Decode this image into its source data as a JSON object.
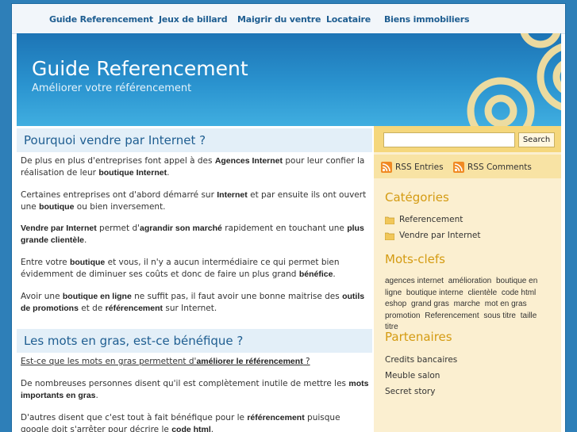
{
  "nav": {
    "items": [
      "Guide Referencement",
      "Jeux de billard",
      "Maigrir du ventre",
      "Locataire",
      "Biens immobiliers"
    ]
  },
  "header": {
    "title": "Guide Referencement",
    "tagline": "Améliorer votre référencement"
  },
  "posts": [
    {
      "title": "Pourquoi vendre par Internet ?",
      "paragraphs": [
        {
          "segments": [
            {
              "t": "De plus en plus d'entreprises font appel à des "
            },
            {
              "t": "Agences Internet",
              "b": true
            },
            {
              "t": " pour leur confier la réalisation de leur "
            },
            {
              "t": "boutique Internet",
              "b": true
            },
            {
              "t": "."
            }
          ]
        },
        {
          "segments": [
            {
              "t": "Certaines entreprises ont d'abord démarré sur "
            },
            {
              "t": "Internet",
              "b": true
            },
            {
              "t": " et par ensuite ils ont ouvert une "
            },
            {
              "t": "boutique",
              "b": true
            },
            {
              "t": " ou bien inversement."
            }
          ]
        },
        {
          "segments": [
            {
              "t": "Vendre par Internet",
              "b": true
            },
            {
              "t": " permet d'"
            },
            {
              "t": "agrandir son marché",
              "b": true
            },
            {
              "t": " rapidement en touchant une "
            },
            {
              "t": "plus grande clientèle",
              "b": true
            },
            {
              "t": "."
            }
          ]
        },
        {
          "segments": [
            {
              "t": "Entre votre "
            },
            {
              "t": "boutique",
              "b": true
            },
            {
              "t": " et vous, il n'y a aucun intermédiaire ce qui permet bien évidemment de diminuer ses coûts et donc de faire un plus grand "
            },
            {
              "t": "bénéfice",
              "b": true
            },
            {
              "t": "."
            }
          ]
        },
        {
          "segments": [
            {
              "t": "Avoir une "
            },
            {
              "t": "boutique en ligne",
              "b": true
            },
            {
              "t": " ne suffit pas, il faut avoir une bonne maitrise des "
            },
            {
              "t": "outils de promotions",
              "b": true
            },
            {
              "t": " et de "
            },
            {
              "t": "référencement",
              "b": true
            },
            {
              "t": " sur Internet."
            }
          ]
        }
      ]
    },
    {
      "title": "Les mots en gras, est-ce bénéfique ?",
      "paragraphs": [
        {
          "segments": [
            {
              "t": "Est-ce que les mots en gras permettent d'",
              "u": true
            },
            {
              "t": "améliorer le référencement",
              "b": true,
              "u": true
            },
            {
              "t": " ?",
              "u": true
            }
          ]
        },
        {
          "segments": [
            {
              "t": "De nombreuses personnes disent qu'il est complètement inutile de mettre les "
            },
            {
              "t": "mots importants en gras",
              "b": true
            },
            {
              "t": "."
            }
          ]
        },
        {
          "segments": [
            {
              "t": "D'autres disent que c'est tout à fait bénéfique pour le "
            },
            {
              "t": "référencement",
              "b": true
            },
            {
              "t": " puisque google doit s'arrêter pour décrire le "
            },
            {
              "t": "code html",
              "b": true
            },
            {
              "t": "."
            }
          ]
        }
      ]
    }
  ],
  "sidebar": {
    "search": {
      "button": "Search",
      "value": ""
    },
    "rss": [
      "RSS Entries",
      "RSS Comments"
    ],
    "categories": {
      "heading": "Catégories",
      "items": [
        "Referencement",
        "Vendre par Internet"
      ]
    },
    "tags": {
      "heading": "Mots-clefs",
      "items": [
        "agences internet",
        "amélioration",
        "boutique en ligne",
        "boutique interne",
        "clientèle",
        "code html",
        "eshop",
        "grand gras",
        "marche",
        "mot en gras",
        "promotion",
        "Referencement",
        "sous titre",
        "taille",
        "titre"
      ]
    },
    "partners": {
      "heading": "Partenaires",
      "items": [
        "Credits bancaires",
        "Meuble salon",
        "Secret story"
      ]
    }
  },
  "colors": {
    "background": "#2e7fb8",
    "nav_link": "#1f5e91",
    "heading_gold": "#d49b12",
    "post_title_bg": "#e3eff8",
    "sidebar_bg": "#fbefd0",
    "rss_orange": "#f08a24"
  }
}
